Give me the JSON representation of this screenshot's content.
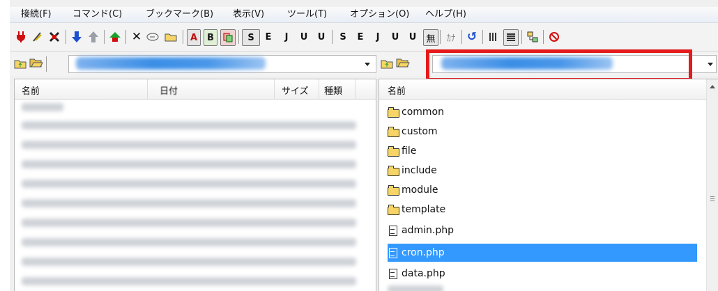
{
  "menu": [
    {
      "label": "接続(F)",
      "underline": "F"
    },
    {
      "label": "コマンド(C)",
      "underline": "C"
    },
    {
      "label": "ブックマーク(B)",
      "underline": "B"
    },
    {
      "label": "表示(V)",
      "underline": "V"
    },
    {
      "label": "ツール(T)",
      "underline": "T"
    },
    {
      "label": "オプション(O)",
      "underline": "O"
    },
    {
      "label": "ヘルプ(H)",
      "underline": "H"
    }
  ],
  "toolbar": {
    "text_buttons": {
      "ascii_a": "A",
      "binary_b": "B",
      "s_mode": "S",
      "e": "E",
      "j": "J",
      "u_utf8n": "U",
      "u_utf8": "U",
      "s2": "S",
      "e2": "E",
      "j2": "J",
      "u2": "U",
      "u3": "U",
      "mu": "無",
      "kana": "ｶﾅ"
    }
  },
  "local_pane": {
    "columns": {
      "name": "名前",
      "date": "日付",
      "size": "サイズ",
      "type": "種類"
    }
  },
  "remote_pane": {
    "columns": {
      "name": "名前"
    },
    "items": [
      {
        "name": "common",
        "kind": "folder"
      },
      {
        "name": "custom",
        "kind": "folder"
      },
      {
        "name": "file",
        "kind": "folder"
      },
      {
        "name": "include",
        "kind": "folder"
      },
      {
        "name": "module",
        "kind": "folder"
      },
      {
        "name": "template",
        "kind": "folder"
      },
      {
        "name": "admin.php",
        "kind": "file"
      },
      {
        "name": "cron.php",
        "kind": "file",
        "selected": true
      },
      {
        "name": "data.php",
        "kind": "file"
      }
    ]
  },
  "colors": {
    "selection": "#3399ff",
    "highlight_box": "#e51a1a"
  }
}
